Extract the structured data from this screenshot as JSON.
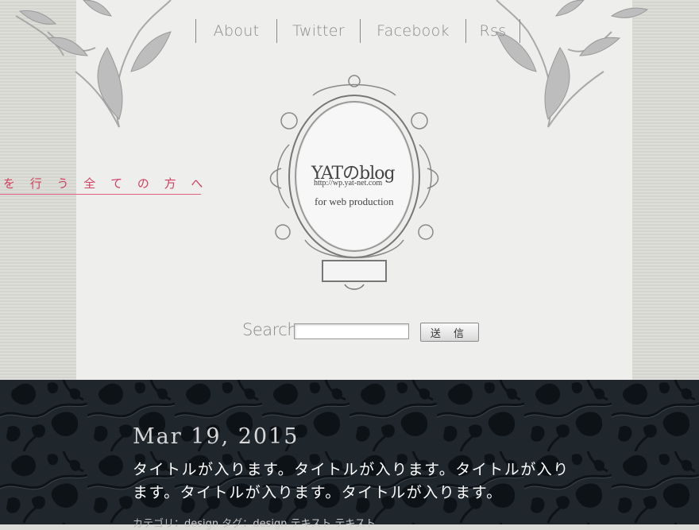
{
  "nav": {
    "items": [
      {
        "label": "About"
      },
      {
        "label": "Twitter"
      },
      {
        "label": "Facebook"
      },
      {
        "label": "Rss"
      }
    ]
  },
  "tagline": "を 行 う 全 て の 方 へ",
  "logo": {
    "title": "YATのblog",
    "url": "http://wp.yat-net.com",
    "subtitle": "for web production"
  },
  "search": {
    "label": "Search",
    "placeholder": "",
    "value": "",
    "button_label": "送 信"
  },
  "post": {
    "date": "Mar 19, 2015",
    "title": "タイトルが入ります。タイトルが入ります。タイトルが入ります。タイトルが入ります。タイトルが入ります。",
    "meta_category_label": "カテゴリ：",
    "meta_category": "design",
    "meta_tag_label": "タグ：",
    "meta_tags": "design テキスト テキスト"
  },
  "colors": {
    "accent": "#d04060",
    "dark_bg": "#1f262c",
    "panel_bg": "#eeeeec"
  }
}
